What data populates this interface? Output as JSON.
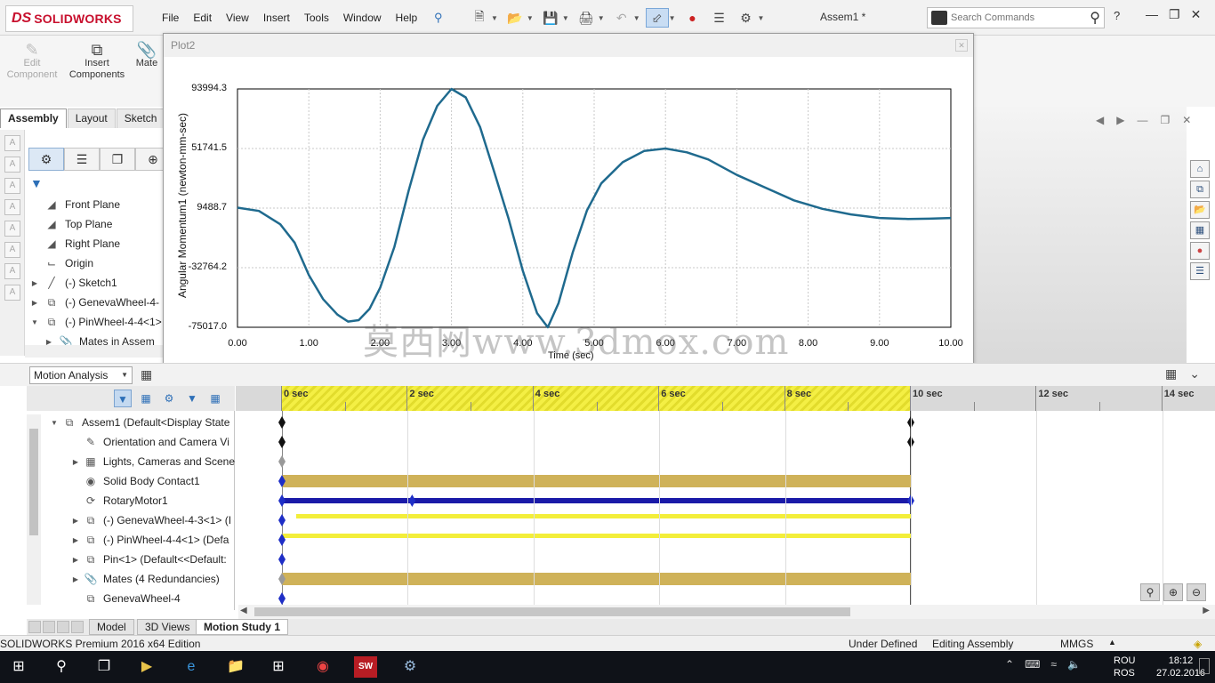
{
  "app": {
    "logo_ds": "DS",
    "logo_name": "SOLIDWORKS",
    "document_title": "Assem1 *",
    "menu": [
      "File",
      "Edit",
      "View",
      "Insert",
      "Tools",
      "Window",
      "Help"
    ],
    "search_placeholder": "Search Commands"
  },
  "command_manager": {
    "edit_component": "Edit Component",
    "insert_components": "Insert Components",
    "mate": "Mate",
    "tabs": [
      "Assembly",
      "Layout",
      "Sketch"
    ]
  },
  "feature_tree": [
    {
      "label": "Front Plane",
      "icon": "plane-icon",
      "expandable": false
    },
    {
      "label": "Top Plane",
      "icon": "plane-icon",
      "expandable": false
    },
    {
      "label": "Right Plane",
      "icon": "plane-icon",
      "expandable": false
    },
    {
      "label": "Origin",
      "icon": "origin-icon",
      "expandable": false
    },
    {
      "label": "(-) Sketch1",
      "icon": "sketch-icon",
      "expandable": true
    },
    {
      "label": "(-) GenevaWheel-4-",
      "icon": "part-icon",
      "expandable": true
    },
    {
      "label": "(-) PinWheel-4-4<1>",
      "icon": "part-icon",
      "expandable": true
    },
    {
      "label": "Mates in Assem",
      "icon": "mates-icon",
      "expandable": true
    }
  ],
  "plot_window": {
    "title": "Plot2",
    "ylabel": "Angular Momentum1 (newton-mm-sec)",
    "xlabel": "Time (sec)"
  },
  "chart_data": {
    "type": "line",
    "title": "",
    "xlabel": "Time (sec)",
    "ylabel": "Angular Momentum1 (newton-mm-sec)",
    "xlim": [
      0,
      10
    ],
    "ylim": [
      -75017.0,
      93994.3
    ],
    "x_ticks": [
      "0.00",
      "1.00",
      "2.00",
      "3.00",
      "4.00",
      "5.00",
      "6.00",
      "7.00",
      "8.00",
      "9.00",
      "10.00"
    ],
    "y_ticks": [
      "93994.3",
      "51741.5",
      "9488.7",
      "-32764.2",
      "-75017.0"
    ],
    "grid": true,
    "line_color": "#1f6a8e",
    "series": [
      {
        "x": [
          0,
          0.3,
          0.6,
          0.8,
          1.0,
          1.2,
          1.4,
          1.55,
          1.7,
          1.85,
          2.0,
          2.2,
          2.4,
          2.6,
          2.8,
          3.0,
          3.2,
          3.4,
          3.6,
          3.8,
          4.0,
          4.2,
          4.35,
          4.5,
          4.7,
          4.9,
          5.1,
          5.4,
          5.7,
          6.0,
          6.3,
          6.6,
          7.0,
          7.4,
          7.8,
          8.2,
          8.6,
          9.0,
          9.4,
          9.7,
          10.0
        ],
        "y": [
          9800,
          7500,
          -2000,
          -15000,
          -38000,
          -55000,
          -66000,
          -71000,
          -70000,
          -62000,
          -47000,
          -18000,
          22000,
          58000,
          82000,
          93994,
          88000,
          67000,
          35000,
          2000,
          -35000,
          -65000,
          -75017,
          -58000,
          -22000,
          8000,
          27000,
          42000,
          50000,
          51741,
          49000,
          44000,
          33000,
          24000,
          15000,
          9000,
          5000,
          2500,
          1800,
          2000,
          2500
        ]
      }
    ]
  },
  "watermark": "莫西网www.3dmox.com",
  "motion_study": {
    "type_select": "Motion Analysis",
    "timeline_labels": [
      "0 sec",
      "2 sec",
      "4 sec",
      "6 sec",
      "8 sec",
      "10 sec",
      "12 sec",
      "14 sec"
    ],
    "tree": [
      {
        "label": "Assem1  (Default<Display State",
        "icon": "assembly-icon",
        "expandable": true,
        "level": 0
      },
      {
        "label": "Orientation and Camera Vi",
        "icon": "camera-icon",
        "expandable": false,
        "level": 1
      },
      {
        "label": "Lights, Cameras and Scene",
        "icon": "lights-icon",
        "expandable": true,
        "level": 1
      },
      {
        "label": "Solid Body Contact1",
        "icon": "contact-icon",
        "expandable": false,
        "level": 1
      },
      {
        "label": "RotaryMotor1",
        "icon": "motor-icon",
        "expandable": false,
        "level": 1
      },
      {
        "label": "(-) GenevaWheel-4-3<1> (I",
        "icon": "part-icon",
        "expandable": true,
        "level": 1
      },
      {
        "label": "(-) PinWheel-4-4<1> (Defa",
        "icon": "part-icon",
        "expandable": true,
        "level": 1
      },
      {
        "label": "Pin<1> (Default<<Default:",
        "icon": "part-icon",
        "expandable": true,
        "level": 1
      },
      {
        "label": "Mates (4 Redundancies)",
        "icon": "mates-icon",
        "expandable": true,
        "level": 1
      },
      {
        "label": "GenevaWheel-4",
        "icon": "part-icon",
        "expandable": false,
        "level": 1
      }
    ]
  },
  "bottom_tabs": [
    "Model",
    "3D Views",
    "Motion Study 1"
  ],
  "status": {
    "edition": "SOLIDWORKS Premium 2016 x64 Edition",
    "defined": "Under Defined",
    "editing": "Editing Assembly",
    "units": "MMGS"
  },
  "taskbar": {
    "lang1": "ROU",
    "lang2": "ROS",
    "time": "18:12",
    "date": "27.02.2016"
  },
  "colors": {
    "solidworks_red": "#c8102e",
    "plot_line": "#1f6a8e",
    "timeline_gold": "#cfb259",
    "timeline_blue": "#1a1aa8",
    "timeline_yellow": "#f3ee3a"
  }
}
